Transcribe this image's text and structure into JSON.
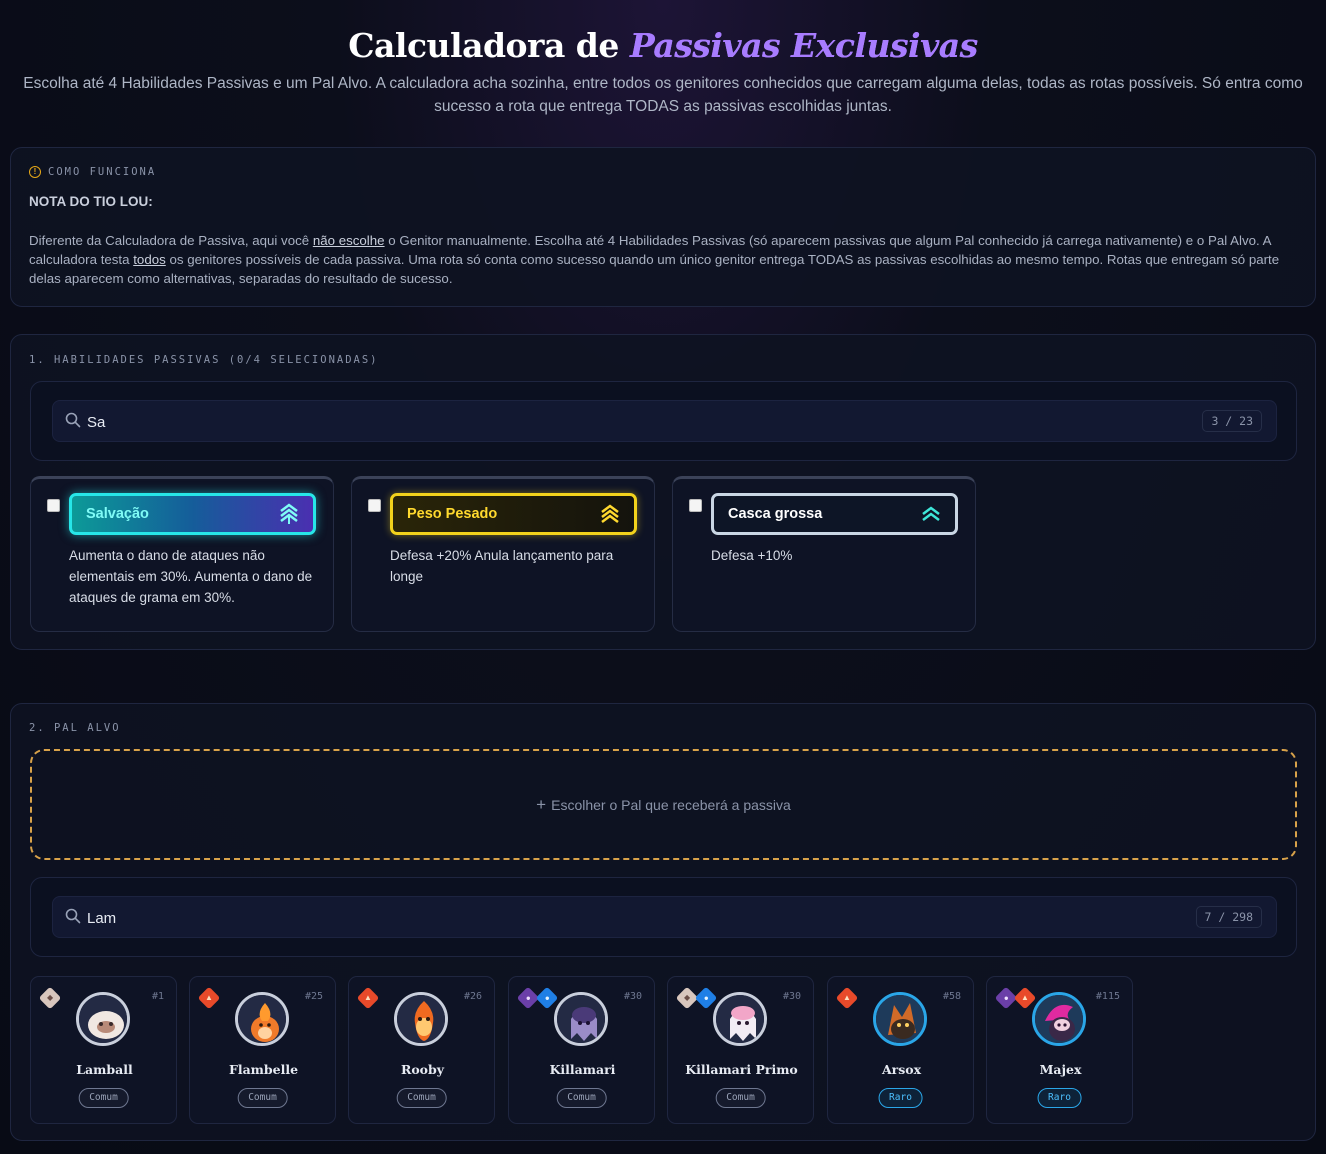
{
  "header": {
    "title_plain": "Calculadora de",
    "title_accent": "Passivas Exclusivas",
    "subtitle": "Escolha até 4 Habilidades Passivas e um Pal Alvo. A calculadora acha sozinha, entre todos os genitores conhecidos que carregam alguma delas, todas as rotas possíveis. Só entra como sucesso a rota que entrega TODAS as passivas escolhidas juntas."
  },
  "info": {
    "label": "COMO FUNCIONA",
    "nota": "NOTA DO TIO LOU:",
    "body_1": "Diferente da Calculadora de Passiva, aqui você ",
    "body_link_1": "não escolhe",
    "body_2": " o Genitor manualmente. Escolha até 4 Habilidades Passivas (só aparecem passivas que algum Pal conhecido já carrega nativamente) e o Pal Alvo. A calculadora testa ",
    "body_link_2": "todos",
    "body_3": " os genitores possíveis de cada passiva. Uma rota só conta como sucesso quando um único genitor entrega TODAS as passivas escolhidas ao mesmo tempo. Rotas que entregam só parte delas aparecem como alternativas, separadas do resultado de sucesso."
  },
  "passives": {
    "section_label": "1. HABILIDADES PASSIVAS (0/4 SELECIONADAS)",
    "search_value": "Sa",
    "search_count": "3 / 23",
    "items": [
      {
        "name": "Salvação",
        "desc": "Aumenta o dano de ataques não elementais em 30%. Aumenta o dano de ataques de grama em 30%.",
        "rank_icon": "rank-up-triple-icon"
      },
      {
        "name": "Peso Pesado",
        "desc": "Defesa +20% Anula lançamento para longe",
        "rank_icon": "rank-up-triple-icon"
      },
      {
        "name": "Casca grossa",
        "desc": "Defesa +10%",
        "rank_icon": "rank-up-double-icon"
      }
    ]
  },
  "pal_alvo": {
    "section_label": "2. PAL ALVO",
    "pick_plus": "+",
    "pick_label": "Escolher o Pal que receberá a passiva",
    "search_value": "Lam",
    "search_count": "7 / 298",
    "pals": [
      {
        "name": "Lamball",
        "number": "#1",
        "rarity": "Comum",
        "elements": [
          "neutral"
        ]
      },
      {
        "name": "Flambelle",
        "number": "#25",
        "rarity": "Comum",
        "elements": [
          "fire"
        ]
      },
      {
        "name": "Rooby",
        "number": "#26",
        "rarity": "Comum",
        "elements": [
          "fire"
        ]
      },
      {
        "name": "Killamari",
        "number": "#30",
        "rarity": "Comum",
        "elements": [
          "dark",
          "water"
        ]
      },
      {
        "name": "Killamari Primo",
        "number": "#30",
        "rarity": "Comum",
        "elements": [
          "neutral",
          "water"
        ]
      },
      {
        "name": "Arsox",
        "number": "#58",
        "rarity": "Raro",
        "elements": [
          "fire"
        ]
      },
      {
        "name": "Majex",
        "number": "#115",
        "rarity": "Raro",
        "elements": [
          "dark",
          "fire"
        ]
      }
    ]
  },
  "colors": {
    "accent_purple": "#a87cff",
    "salvacao_teal": "#27e6e8",
    "peso_yellow": "#f2d21c",
    "dashed_orange": "#d8a24a",
    "rare_blue": "#2aa6e8"
  }
}
